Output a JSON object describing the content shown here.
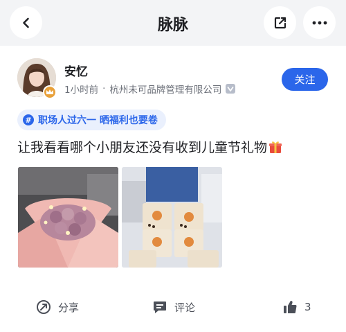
{
  "header": {
    "title": "脉脉",
    "back_icon": "chevron-left-icon",
    "share_icon": "share-export-icon",
    "more_icon": "more-dots-icon",
    "background": "#f3f4f6"
  },
  "post": {
    "author": {
      "name": "安忆",
      "time": "1小时前",
      "separator": "·",
      "company": "杭州未可品牌管理有限公司",
      "badge_icon": "crown-badge-icon",
      "verified_icon": "verified-icon"
    },
    "follow_label": "关注",
    "topic": {
      "icon": "#",
      "label": "职场人过六一  晒福利也要卷"
    },
    "content": "让我看看哪个小朋友还没有收到儿童节礼物",
    "content_emoji": "gift-icon",
    "photos": [
      {
        "icon": "flower-bouquet-image"
      },
      {
        "icon": "bubble-tea-cups-image"
      }
    ]
  },
  "actions": {
    "share_label": "分享",
    "comment_label": "评论",
    "like_count": "3"
  },
  "colors": {
    "accent": "#2b66ea",
    "topic_bg": "#eaf0fd",
    "text": "#1f2024",
    "muted": "#6b6f78"
  }
}
